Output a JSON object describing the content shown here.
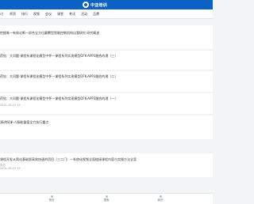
{
  "header": {
    "brand": "中亚培训"
  },
  "nav": {
    "items": [
      {
        "label": "讨"
      },
      {
        "label": "师资"
      },
      {
        "label": "排行"
      },
      {
        "label": "视频"
      },
      {
        "label": "会议"
      },
      {
        "label": "课堂"
      },
      {
        "label": "考试"
      },
      {
        "label": "活动"
      },
      {
        "label": "品牌"
      }
    ]
  },
  "list": {
    "items": [
      {
        "title": "挖掘唯一有效论断一综合全方位颠覆型智能控制机构自我研究 研究概述",
        "meta": ""
      },
      {
        "title": "药钻：大问题·课程系课程化模型中怀—课程系列实现模型DFK-APP3融合的理（三）",
        "meta": ""
      },
      {
        "title": "药钻：大问题·课程系课程化模型中怀—课程系列实现模型DFK-APP3融合的理（二）",
        "meta": ""
      },
      {
        "title": "药钻：大问题·课程系课程化模型中怀—课程系列实现模型DFK-APP3融合的理（一）",
        "meta": "2021.10.12 15"
      },
      {
        "title": "演讲授课·人脉能量值全力执行重点",
        "meta": ""
      },
      {
        "title": "课程开发从简化基础版高效快速的项目（三二门）—系统化视频全面链接课程内容与实操方法全案",
        "meta": "东方\n2021.10.12 15"
      }
    ]
  },
  "tabbar": {
    "items": [
      {
        "label": "首页"
      },
      {
        "label": "搜索"
      },
      {
        "label": "我的"
      }
    ]
  }
}
